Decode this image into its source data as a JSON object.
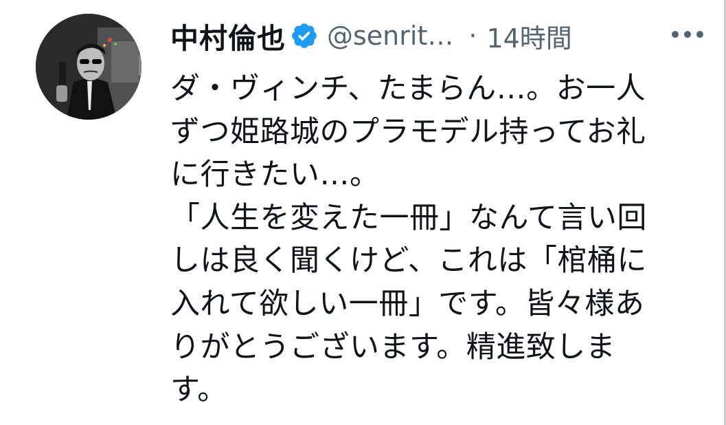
{
  "tweet": {
    "author": {
      "display_name": "中村倫也",
      "handle": "@senrit…",
      "verified": true,
      "avatar_icon": "profile-photo"
    },
    "separator": "·",
    "timestamp": "14時間",
    "more_icon": "more-horizontal-icon",
    "verified_icon": "verified-badge-icon",
    "text_lines": [
      "ダ・ヴィンチ、たまらん…。お一人",
      "ずつ姫路城のプラモデル持ってお礼",
      "に行きたい…。",
      "「人生を変えた一冊」なんて言い回",
      "しは良く聞くけど、これは「棺桶に",
      "入れて欲しい一冊」です。皆々様あ",
      "りがとうございます。精進致しま",
      "す。"
    ]
  },
  "colors": {
    "text_primary": "#0f1419",
    "text_secondary": "#536471",
    "verified_blue": "#1d9bf0",
    "background": "#ffffff"
  }
}
